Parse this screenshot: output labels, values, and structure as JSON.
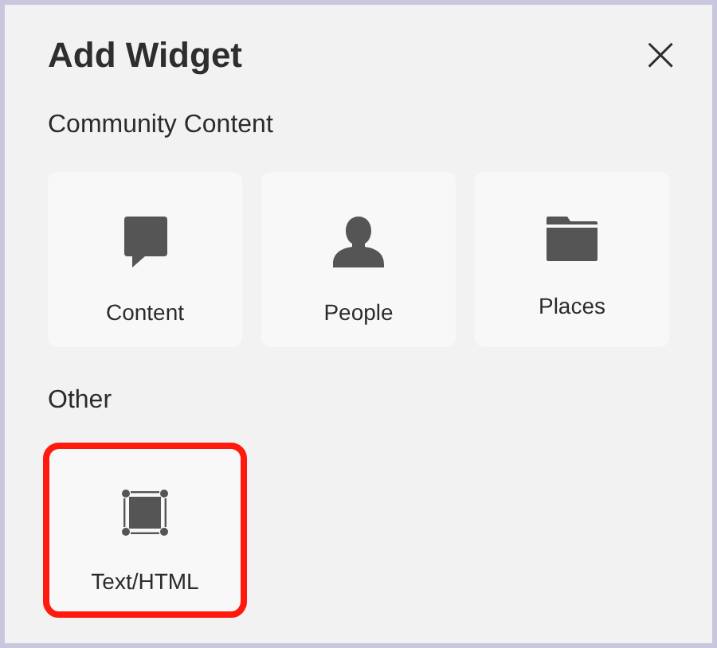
{
  "dialog": {
    "title": "Add Widget",
    "close": "×"
  },
  "sections": [
    {
      "heading": "Community Content",
      "items": [
        {
          "kind": "chat",
          "label": "Content",
          "highlighted": false
        },
        {
          "kind": "person",
          "label": "People",
          "highlighted": false
        },
        {
          "kind": "folder",
          "label": "Places",
          "highlighted": false
        }
      ]
    },
    {
      "heading": "Other",
      "items": [
        {
          "kind": "frame",
          "label": "Text/HTML",
          "highlighted": true
        }
      ]
    }
  ]
}
